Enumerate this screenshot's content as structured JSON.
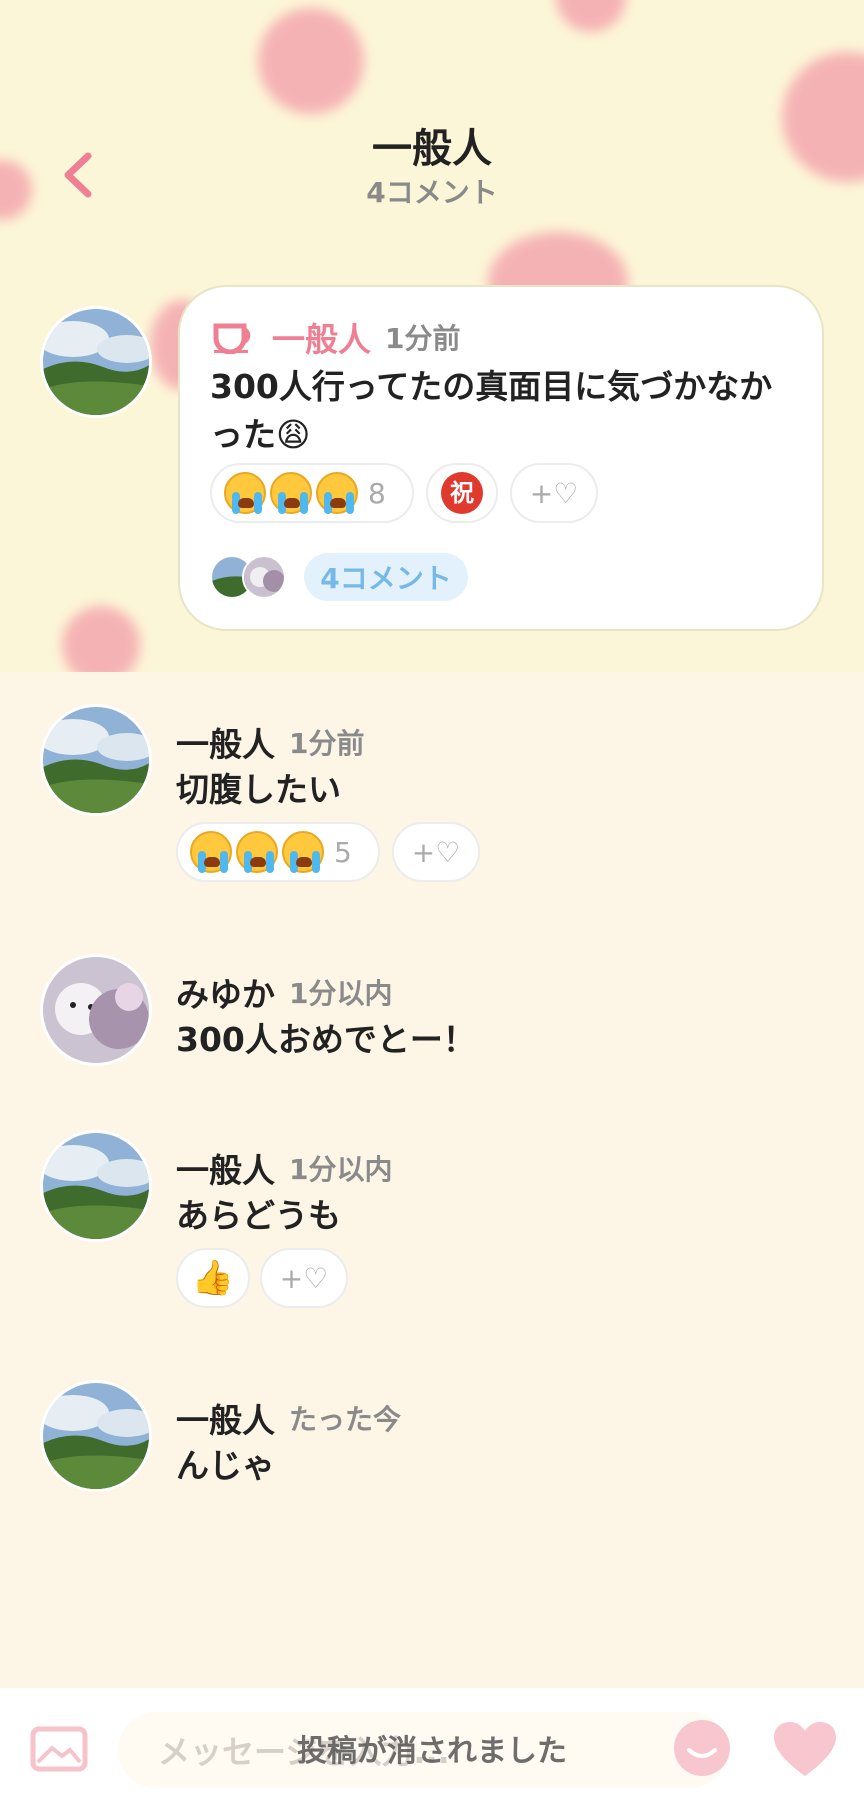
{
  "header": {
    "title": "一般人",
    "subtitle": "4コメント"
  },
  "post": {
    "name": "一般人",
    "time": "1分前",
    "message": "300人行ってたの真面目に気づかなかった😩",
    "reactions": {
      "cry_count": "8",
      "add_label": "+♡"
    },
    "comments_label": "4コメント"
  },
  "comments": [
    {
      "name": "一般人",
      "time": "1分前",
      "text": "切腹したい",
      "reaction_count": "5",
      "add_label": "+♡"
    },
    {
      "name": "みゆか",
      "time": "1分以内",
      "text": "300人おめでとー！"
    },
    {
      "name": "一般人",
      "time": "1分以内",
      "text": "あらどうも",
      "reaction": "👍",
      "add_label": "+♡"
    },
    {
      "name": "一般人",
      "time": "たった今",
      "text": "んじゃ"
    }
  ],
  "composer": {
    "placeholder": "メッセージを入力..."
  },
  "toast": "投稿が消されました",
  "colors": {
    "accent_pink": "#ef7f93",
    "pill_blue": "#76b9e6"
  }
}
